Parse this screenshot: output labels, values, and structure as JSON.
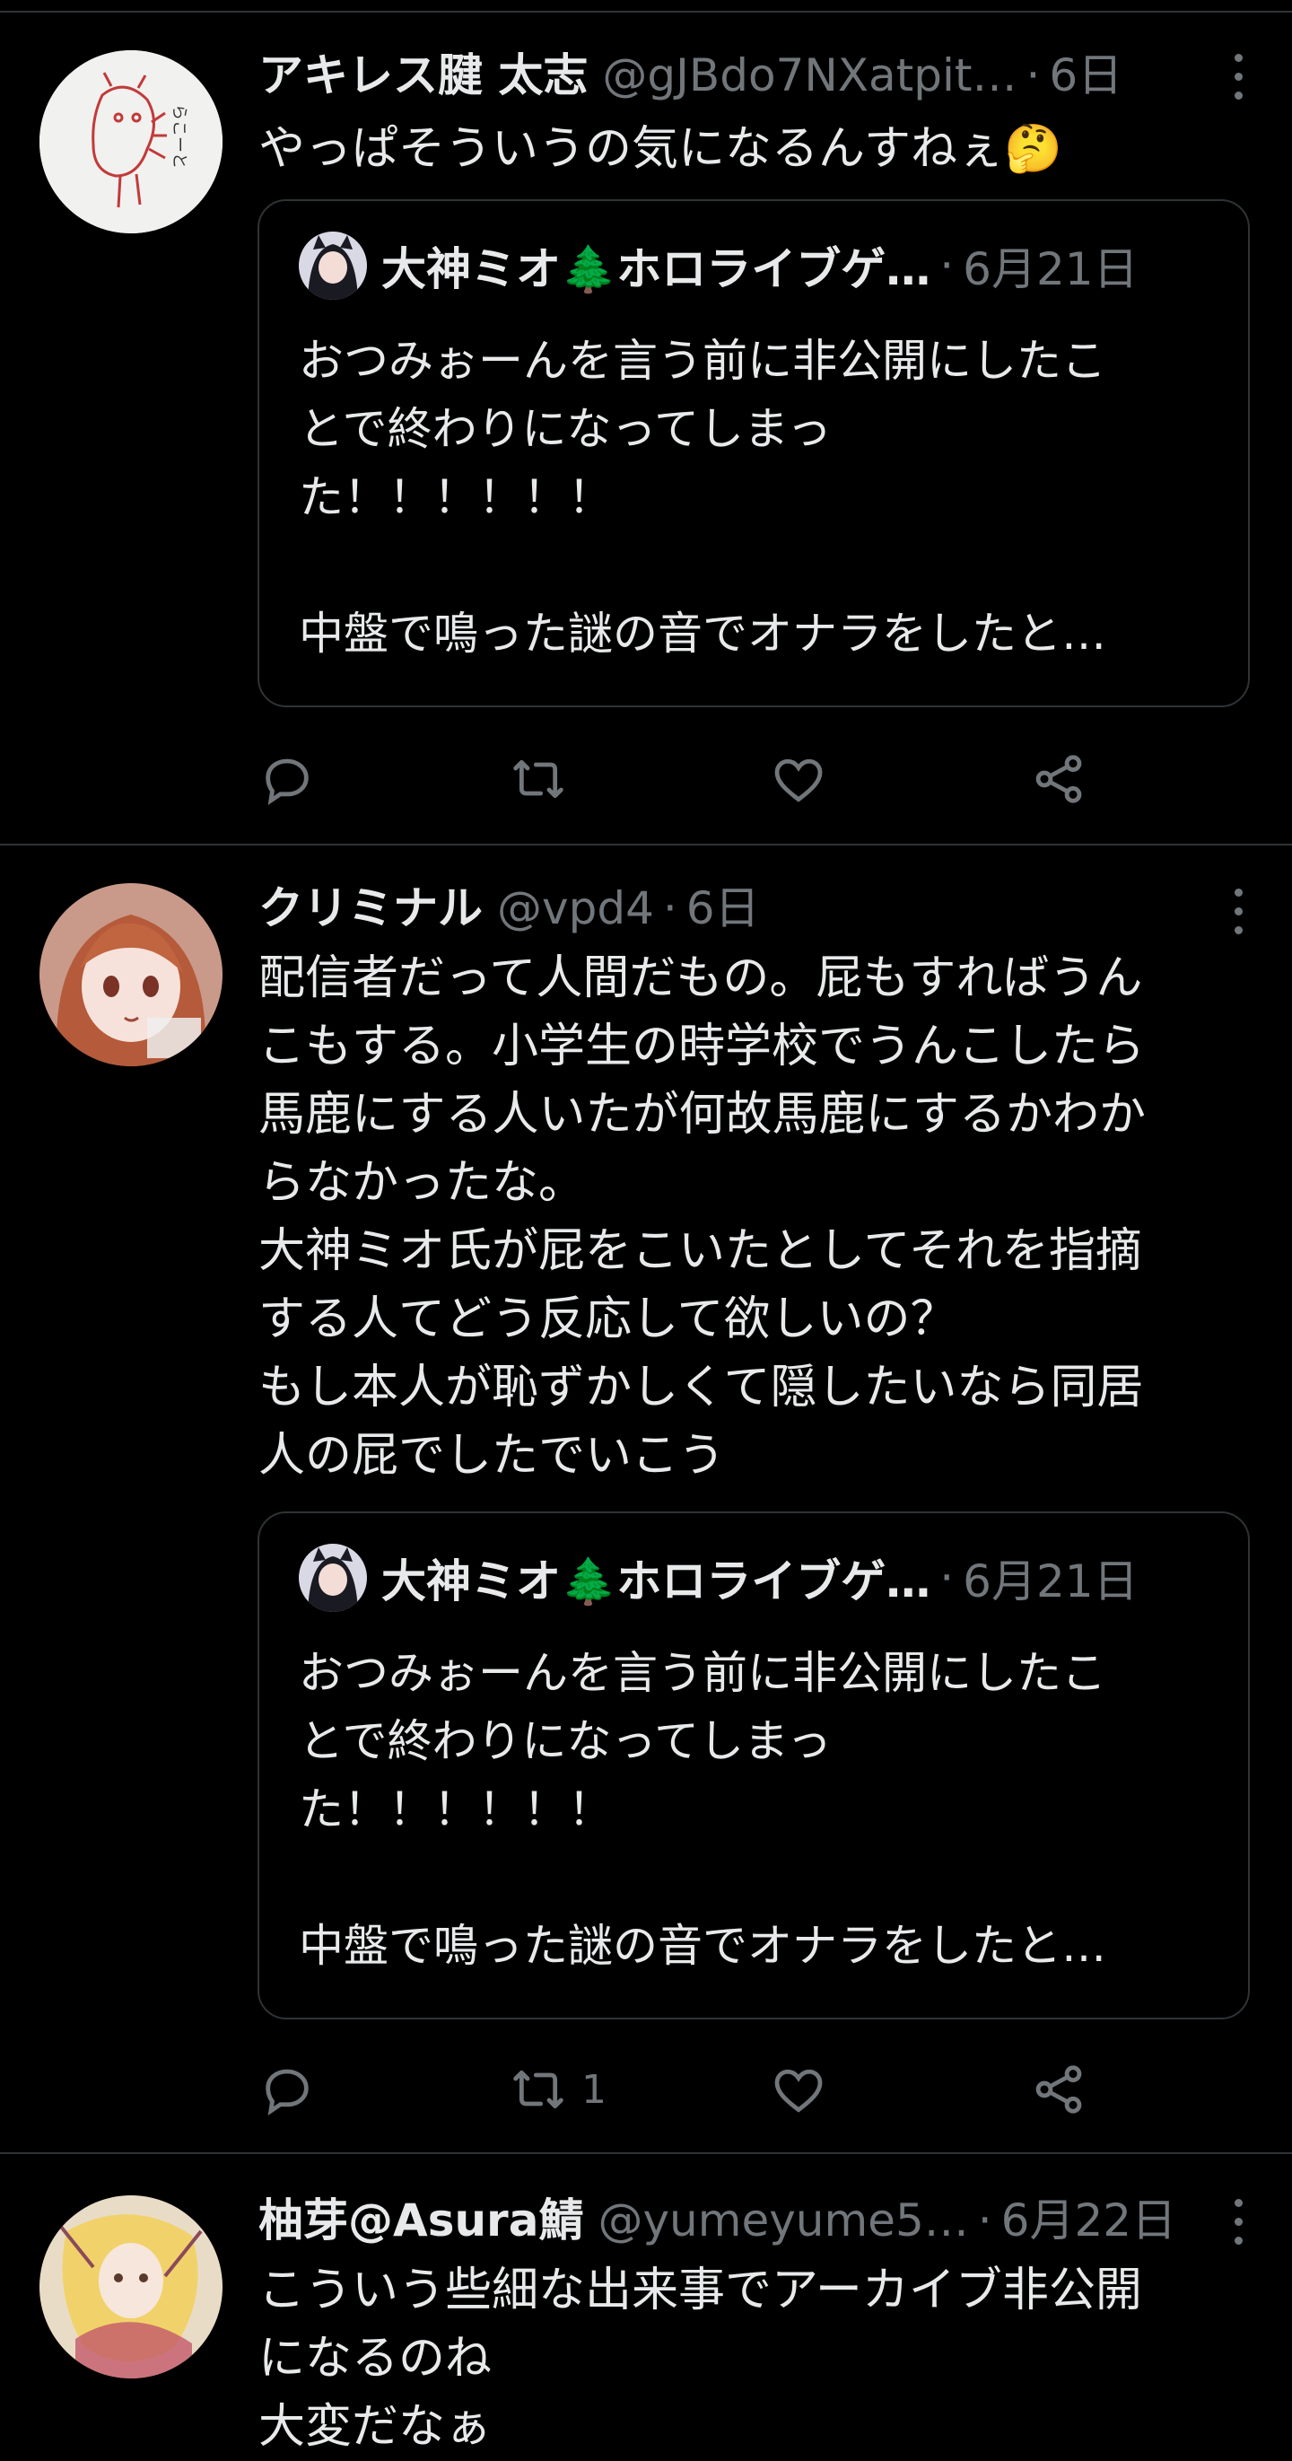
{
  "tweets": [
    {
      "name": "アキレス腱 太志",
      "handle": "@gJBdo7NXatpit…",
      "separator": "·",
      "time": "6日",
      "text": "やっぱそういうの気になるんすねぇ🤔",
      "avatar_icon": "sketch-avatar",
      "avatar_text": "らこーと",
      "quote": {
        "name": "大神ミオ🌲ホロライブゲ…",
        "separator": "·",
        "time": "6月21日",
        "text": "おつみぉーんを言う前に非公開にしたこ\nとで終わりになってしまっ\nた！！！！！！\n\n中盤で鳴った謎の音でオナラをしたと…"
      },
      "retweet_count": "",
      "actions": {
        "reply": "reply-icon",
        "retweet": "retweet-icon",
        "like": "heart-icon",
        "share": "share-icon"
      }
    },
    {
      "name": "クリミナル",
      "handle": "@vpd4",
      "separator": "·",
      "time": "6日",
      "text": "配信者だって人間だもの。屁もすればうん\nこもする。小学生の時学校でうんこしたら\n馬鹿にする人いたが何故馬鹿にするかわか\nらなかったな。\n大神ミオ氏が屁をこいたとしてそれを指摘\nする人てどう反応して欲しいの？\nもし本人が恥ずかしくて隠したいなら同居\n人の屁でしたでいこう",
      "avatar_icon": "anime-girl-avatar",
      "quote": {
        "name": "大神ミオ🌲ホロライブゲ…",
        "separator": "·",
        "time": "6月21日",
        "text": "おつみぉーんを言う前に非公開にしたこ\nとで終わりになってしまっ\nた！！！！！！\n\n中盤で鳴った謎の音でオナラをしたと…"
      },
      "retweet_count": "1",
      "actions": {
        "reply": "reply-icon",
        "retweet": "retweet-icon",
        "like": "heart-icon",
        "share": "share-icon"
      }
    },
    {
      "name": "柚芽@Asura鯖",
      "handle": "@yumeyume5…",
      "separator": "·",
      "time": "6月22日",
      "text": "こういう些細な出来事でアーカイブ非公開\nになるのね\n大変だなぁ",
      "avatar_icon": "illustrated-avatar"
    }
  ],
  "colors": {
    "background": "#000000",
    "text": "#e7e9ea",
    "muted": "#71767b",
    "border": "#2f3336"
  }
}
